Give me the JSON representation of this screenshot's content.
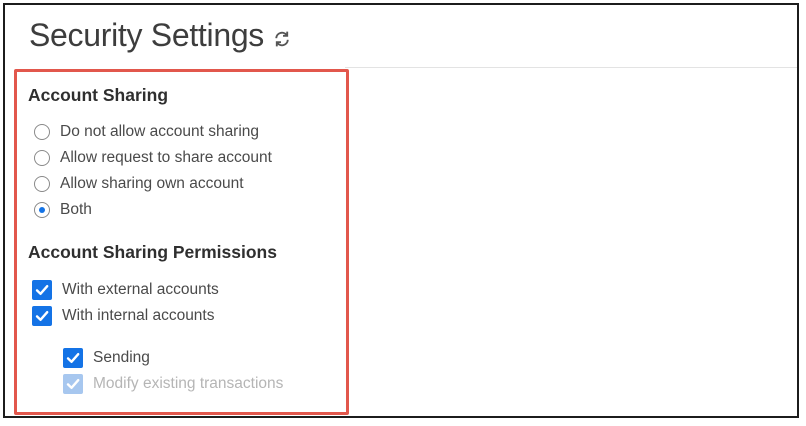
{
  "page": {
    "title": "Security Settings",
    "refresh_icon": "refresh-icon"
  },
  "account_sharing": {
    "heading": "Account Sharing",
    "selected": "Both",
    "options": [
      {
        "label": "Do not allow account sharing",
        "checked": false
      },
      {
        "label": "Allow request to share account",
        "checked": false
      },
      {
        "label": "Allow sharing own account",
        "checked": false
      },
      {
        "label": "Both",
        "checked": true
      }
    ]
  },
  "permissions": {
    "heading": "Account Sharing Permissions",
    "items": [
      {
        "label": "With external accounts",
        "checked": true,
        "disabled": false
      },
      {
        "label": "With internal accounts",
        "checked": true,
        "disabled": false
      }
    ],
    "sub_items": [
      {
        "label": "Sending",
        "checked": true,
        "disabled": false
      },
      {
        "label": "Modify existing transactions",
        "checked": true,
        "disabled": true
      }
    ]
  },
  "colors": {
    "accent": "#1473e6",
    "accent_disabled": "#a7c7ef",
    "highlight_border": "#e2574c"
  }
}
